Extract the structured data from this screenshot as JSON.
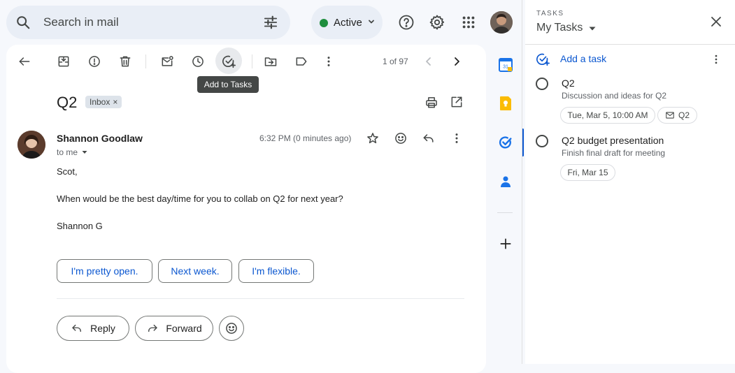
{
  "search": {
    "placeholder": "Search in mail",
    "icon": "search-icon",
    "filter_icon": "tune-icon"
  },
  "status": {
    "label": "Active",
    "color": "#1e8e3e"
  },
  "header_icons": [
    "help-icon",
    "gear-icon",
    "apps-icon"
  ],
  "toolbar": {
    "actions": [
      "back",
      "archive",
      "report-spam",
      "delete",
      "mark-unread",
      "snooze",
      "add-to-tasks",
      "move-to",
      "labels",
      "more"
    ],
    "tooltip": "Add to Tasks",
    "count": "1 of 97"
  },
  "email": {
    "subject": "Q2",
    "label_chip": "Inbox",
    "label_chip_close": "×",
    "sender": "Shannon Goodlaw",
    "recipient": "to me",
    "time": "6:32 PM (0 minutes ago)",
    "body": [
      "Scot,",
      "When would be the best day/time for you to collab on Q2 for next year?",
      "Shannon G"
    ]
  },
  "smart_replies": [
    "I'm pretty open.",
    "Next week.",
    "I'm flexible."
  ],
  "actions": {
    "reply": "Reply",
    "forward": "Forward"
  },
  "side_rail": [
    "calendar",
    "keep",
    "tasks",
    "contacts",
    "add"
  ],
  "tasks_panel": {
    "kicker": "TASKS",
    "title": "My Tasks",
    "add_task": "Add a task",
    "items": [
      {
        "title": "Q2",
        "description": "Discussion and ideas for Q2",
        "due": "Tue, Mar 5, 10:00 AM",
        "link": "Q2"
      },
      {
        "title": "Q2 budget presentation",
        "description": "Finish final draft for meeting",
        "due": "Fri, Mar 15"
      }
    ]
  },
  "colors": {
    "accent": "#0b57d0",
    "surface": "#f6f8fc",
    "calendar_blue": "#1a73e8",
    "keep_yellow": "#fbbc04"
  }
}
